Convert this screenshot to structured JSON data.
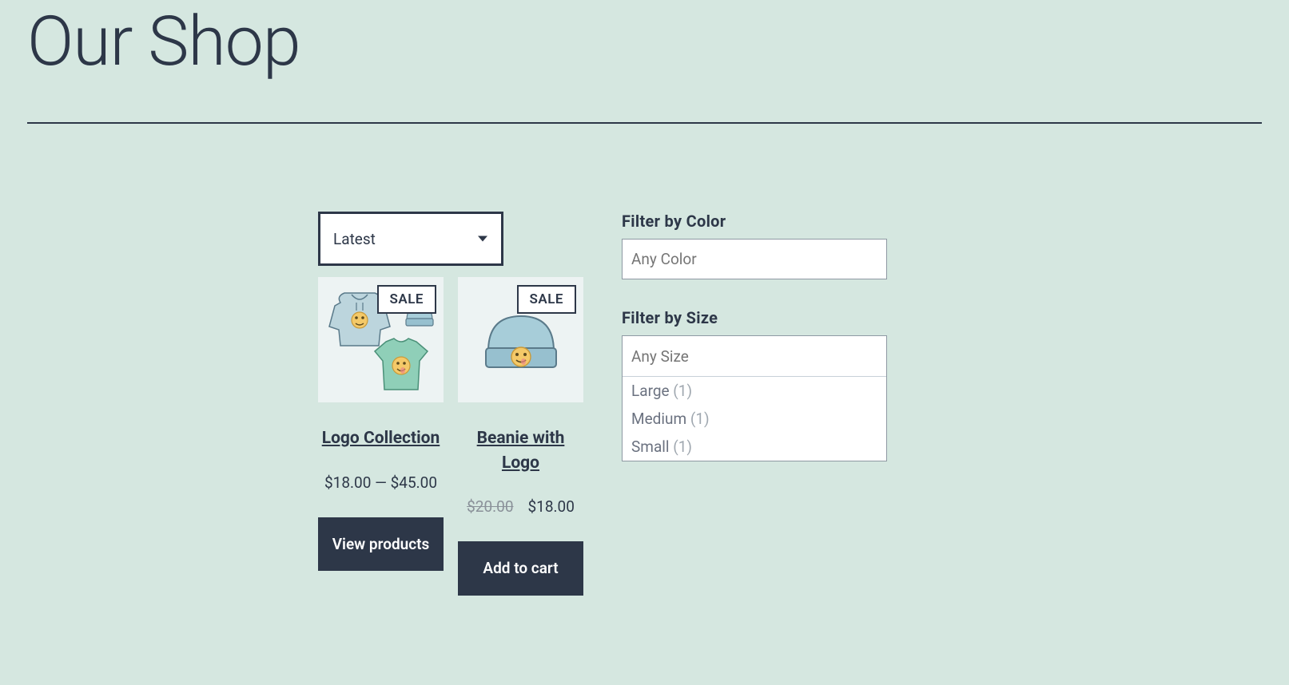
{
  "page": {
    "title": "Our Shop"
  },
  "sort": {
    "selected": "Latest"
  },
  "products": [
    {
      "badge": "SALE",
      "title": "Logo Collection",
      "price_display": "$18.00 — $45.00",
      "has_strike": false,
      "button": "View products",
      "image_type": "collection"
    },
    {
      "badge": "SALE",
      "title": "Beanie with Logo",
      "price_strike": "$20.00",
      "price_display": "$18.00",
      "has_strike": true,
      "button": "Add to cart",
      "image_type": "beanie"
    }
  ],
  "filters": {
    "color": {
      "label": "Filter by Color",
      "placeholder": "Any Color"
    },
    "size": {
      "label": "Filter by Size",
      "placeholder": "Any Size",
      "options": [
        {
          "name": "Large",
          "count": "(1)"
        },
        {
          "name": "Medium",
          "count": "(1)"
        },
        {
          "name": "Small",
          "count": "(1)"
        }
      ]
    }
  }
}
